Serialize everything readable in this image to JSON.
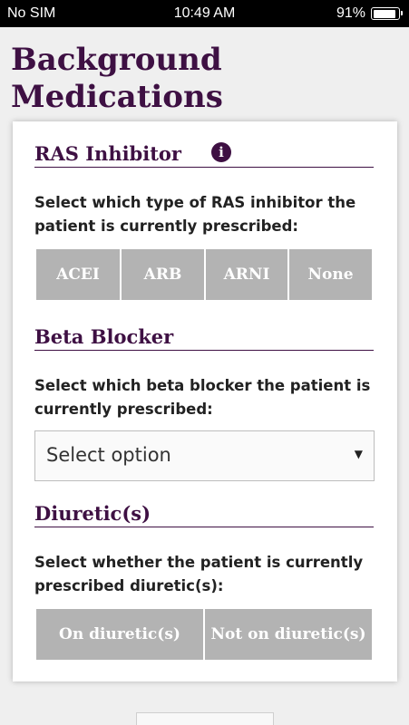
{
  "status_bar": {
    "carrier": "No SIM",
    "time": "10:49 AM",
    "battery": "91%",
    "battery_level": 0.91
  },
  "page": {
    "title_line1": "Background",
    "title_line2": "Medications"
  },
  "ras": {
    "heading": "RAS Inhibitor",
    "info_glyph": "i",
    "prompt": "Select which type of RAS inhibitor the patient is currently prescribed:",
    "options": [
      "ACEI",
      "ARB",
      "ARNI",
      "None"
    ]
  },
  "beta": {
    "heading": "Beta Blocker",
    "prompt": "Select which beta blocker the patient is currently prescribed:",
    "select_value": "Select option",
    "caret": "▼"
  },
  "diuretic": {
    "heading": "Diuretic(s)",
    "prompt": "Select whether the patient is currently prescribed diuretic(s):",
    "options": [
      "On diuretic(s)",
      "Not on diuretic(s)"
    ]
  },
  "colors": {
    "brand": "#3e1043",
    "button": "#b3b3b3"
  }
}
